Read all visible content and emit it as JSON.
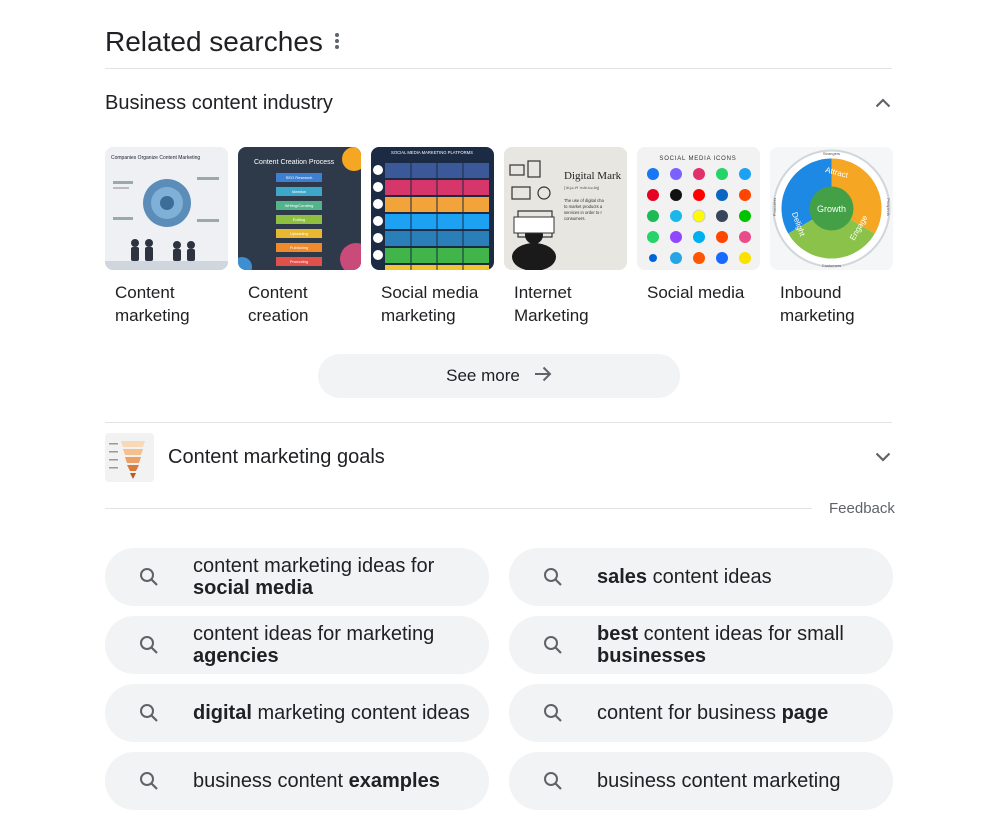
{
  "header": {
    "title": "Related searches"
  },
  "section1": {
    "title": "Business content industry",
    "thumbnails": [
      {
        "label_line1": "Content",
        "label_line2": "marketing"
      },
      {
        "label_line1": "Content",
        "label_line2": "creation"
      },
      {
        "label_line1": "Social media",
        "label_line2": "marketing"
      },
      {
        "label_line1": "Internet",
        "label_line2": "Marketing"
      },
      {
        "label_line1": "Social media",
        "label_line2": ""
      },
      {
        "label_line1": "Inbound",
        "label_line2": "marketing"
      }
    ],
    "thumb_texts": {
      "t1_title": "Companies Organize Content Marketing",
      "t2_title": "Content Creation Process",
      "t2_steps": [
        "SEO Research",
        "Ideation",
        "Writing/Curating",
        "Editing",
        "Uploading",
        "Publishing",
        "Promoting"
      ],
      "t3_title": "SOCIAL MEDIA MARKETING PLATFORMS",
      "t4_title": "Digital Mark",
      "t4_sub": "['di-jə-tᵊl 'mär-kə-tiŋ]",
      "t4_body": "The use of digital cha to market products a services in order to r consumers.",
      "t5_title": "SOCIAL MEDIA ICONS",
      "t6_center": "Growth",
      "t6_attract": "Attract",
      "t6_engage": "Engage",
      "t6_delight": "Delight",
      "t6_strangers": "Strangers",
      "t6_prospects": "Prospects",
      "t6_customers": "Customers",
      "t6_promoters": "Promoters"
    },
    "see_more": "See more"
  },
  "section2": {
    "title": "Content marketing goals"
  },
  "feedback": "Feedback",
  "suggestions": [
    {
      "pre": "content marketing ideas for ",
      "bold": "social media",
      "post": ""
    },
    {
      "pre": "",
      "bold": "sales",
      "post": " content ideas"
    },
    {
      "pre": "content ideas for marketing ",
      "bold": "agencies",
      "post": ""
    },
    {
      "pre": "",
      "bold": "best",
      "post": " content ideas for small ",
      "bold2": "businesses"
    },
    {
      "pre": "",
      "bold": "digital",
      "post": " marketing content ideas"
    },
    {
      "pre": "content for business ",
      "bold": "page",
      "post": ""
    },
    {
      "pre": "business content ",
      "bold": "examples",
      "post": ""
    },
    {
      "pre": "business content marketing",
      "bold": "",
      "post": ""
    }
  ],
  "colors": {
    "chip_bg": "#f1f3f4",
    "text": "#202124",
    "muted": "#5f6368",
    "growth_green": "#4caf50",
    "attract_orange": "#f5a623",
    "engage_green": "#8bc34a",
    "delight_blue": "#1e88e5"
  }
}
